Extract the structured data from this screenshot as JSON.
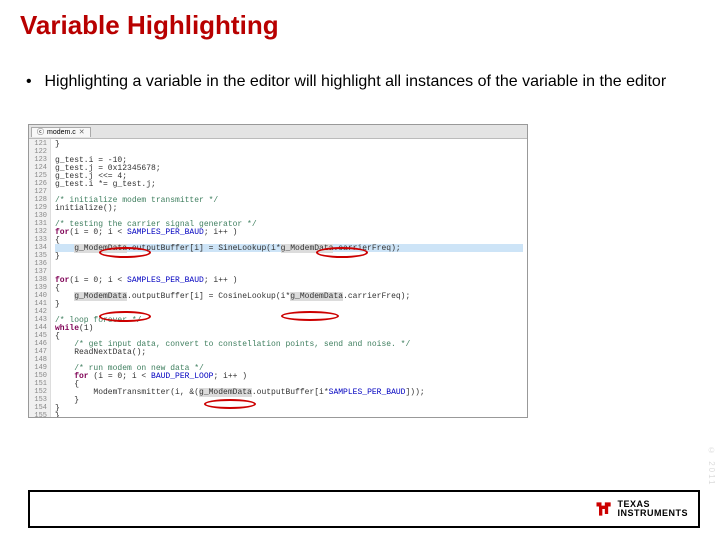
{
  "title": "Variable Highlighting",
  "bullet": "Highlighting a variable in the editor will highlight all instances of the variable in the editor",
  "editor": {
    "tab": "modem.c",
    "lines": [
      {
        "n": 121,
        "t": "}"
      },
      {
        "n": 122,
        "t": ""
      },
      {
        "n": 123,
        "t": "g_test.i = -10;"
      },
      {
        "n": 124,
        "t": "g_test.j = 0x12345678;"
      },
      {
        "n": 125,
        "t": "g_test.j <<= 4;"
      },
      {
        "n": 126,
        "t": "g_test.i *= g_test.j;"
      },
      {
        "n": 127,
        "t": ""
      },
      {
        "n": 128,
        "t": "/* initialize modem transmitter */",
        "c": true
      },
      {
        "n": 129,
        "t": "initialize();"
      },
      {
        "n": 130,
        "t": ""
      },
      {
        "n": 131,
        "t": "/* testing the carrier signal generator */",
        "c": true
      },
      {
        "n": 132,
        "t": "for(i = 0; i < SAMPLES_PER_BAUD; i++ )"
      },
      {
        "n": 133,
        "t": "{"
      },
      {
        "n": 134,
        "t": "    g_ModemData.outputBuffer[i] = SineLookup(i*g_ModemData.carrierFreq);",
        "hl": true
      },
      {
        "n": 135,
        "t": "}"
      },
      {
        "n": 136,
        "t": ""
      },
      {
        "n": 137,
        "t": ""
      },
      {
        "n": 138,
        "t": "for(i = 0; i < SAMPLES_PER_BAUD; i++ )"
      },
      {
        "n": 139,
        "t": "{"
      },
      {
        "n": 140,
        "t": "    g_ModemData.outputBuffer[i] = CosineLookup(i*g_ModemData.carrierFreq);"
      },
      {
        "n": 141,
        "t": "}"
      },
      {
        "n": 142,
        "t": ""
      },
      {
        "n": 143,
        "t": "/* loop forever */",
        "c": true
      },
      {
        "n": 144,
        "t": "while(1)"
      },
      {
        "n": 145,
        "t": "{"
      },
      {
        "n": 146,
        "t": "    /* get input data, convert to constellation points, send and noise. */",
        "c": true
      },
      {
        "n": 147,
        "t": "    ReadNextData();"
      },
      {
        "n": 148,
        "t": ""
      },
      {
        "n": 149,
        "t": "    /* run modem on new data */",
        "c": true
      },
      {
        "n": 150,
        "t": "    for (i = 0; i < BAUD_PER_LOOP; i++ )"
      },
      {
        "n": 151,
        "t": "    {"
      },
      {
        "n": 152,
        "t": "        ModemTransmitter(i, &(g_ModemData.outputBuffer[i*SAMPLES_PER_BAUD]));"
      },
      {
        "n": 153,
        "t": "    }"
      },
      {
        "n": 154,
        "t": "}"
      },
      {
        "n": 155,
        "t": "}"
      }
    ]
  },
  "highlight_variable": "g_ModemData",
  "logo": {
    "line1": "TEXAS",
    "line2": "INSTRUMENTS"
  },
  "side_text": "© 2011"
}
